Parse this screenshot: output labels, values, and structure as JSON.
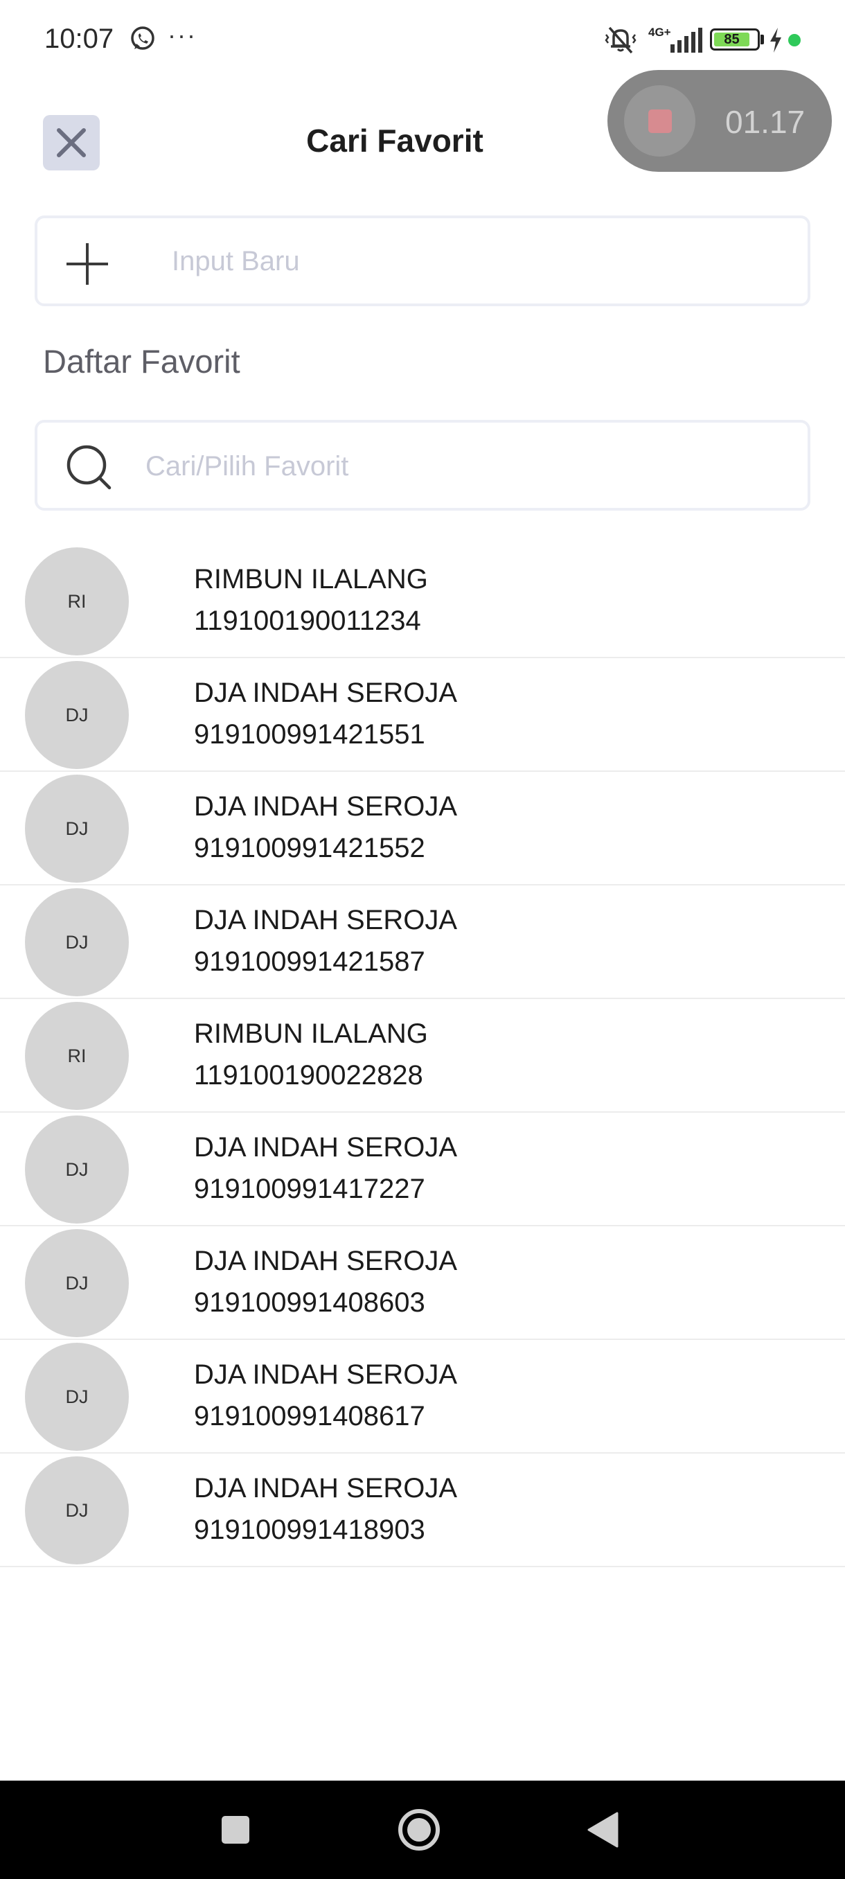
{
  "status_bar": {
    "time": "10:07",
    "network": "4G+",
    "battery": "85",
    "battery_level": 0.85,
    "icons": [
      "whatsapp-icon",
      "more-icon",
      "mute-vibrate-icon",
      "signal-icon",
      "battery-icon",
      "charging-icon",
      "privacy-dot-icon"
    ]
  },
  "header": {
    "title": "Cari Favorit"
  },
  "recorder": {
    "time": "01.17"
  },
  "new_input": {
    "placeholder": "Input Baru"
  },
  "section": {
    "label": "Daftar Favorit"
  },
  "search": {
    "placeholder": "Cari/Pilih Favorit",
    "value": ""
  },
  "favorites": [
    {
      "initials": "RI",
      "name": "RIMBUN ILALANG",
      "number": "119100190011234"
    },
    {
      "initials": "DJ",
      "name": "DJA INDAH SEROJA",
      "number": "919100991421551"
    },
    {
      "initials": "DJ",
      "name": "DJA INDAH SEROJA",
      "number": "919100991421552"
    },
    {
      "initials": "DJ",
      "name": "DJA INDAH SEROJA",
      "number": "919100991421587"
    },
    {
      "initials": "RI",
      "name": "RIMBUN ILALANG",
      "number": "119100190022828"
    },
    {
      "initials": "DJ",
      "name": "DJA INDAH SEROJA",
      "number": "919100991417227"
    },
    {
      "initials": "DJ",
      "name": "DJA INDAH SEROJA",
      "number": "919100991408603"
    },
    {
      "initials": "DJ",
      "name": "DJA INDAH SEROJA",
      "number": "919100991408617"
    },
    {
      "initials": "DJ",
      "name": "DJA INDAH SEROJA",
      "number": "919100991418903"
    }
  ],
  "colors": {
    "close_button_bg": "#d8dbe8",
    "avatar_bg": "#d5d5d5",
    "recorder_bg": "#868686",
    "placeholder": "#c7c9d6",
    "battery_fill": "#7ed957"
  }
}
